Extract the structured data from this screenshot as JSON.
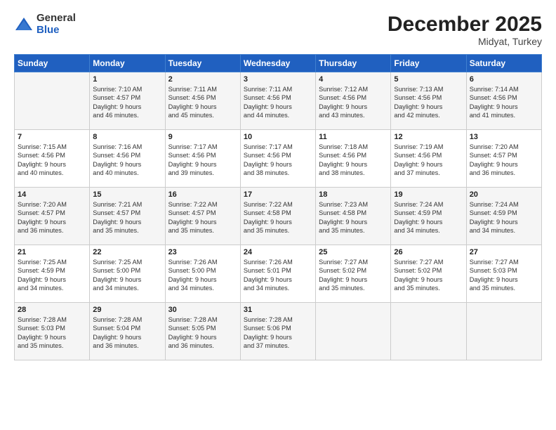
{
  "logo": {
    "general": "General",
    "blue": "Blue"
  },
  "title": "December 2025",
  "subtitle": "Midyat, Turkey",
  "header_days": [
    "Sunday",
    "Monday",
    "Tuesday",
    "Wednesday",
    "Thursday",
    "Friday",
    "Saturday"
  ],
  "weeks": [
    [
      {
        "day": "",
        "lines": []
      },
      {
        "day": "1",
        "lines": [
          "Sunrise: 7:10 AM",
          "Sunset: 4:57 PM",
          "Daylight: 9 hours",
          "and 46 minutes."
        ]
      },
      {
        "day": "2",
        "lines": [
          "Sunrise: 7:11 AM",
          "Sunset: 4:56 PM",
          "Daylight: 9 hours",
          "and 45 minutes."
        ]
      },
      {
        "day": "3",
        "lines": [
          "Sunrise: 7:11 AM",
          "Sunset: 4:56 PM",
          "Daylight: 9 hours",
          "and 44 minutes."
        ]
      },
      {
        "day": "4",
        "lines": [
          "Sunrise: 7:12 AM",
          "Sunset: 4:56 PM",
          "Daylight: 9 hours",
          "and 43 minutes."
        ]
      },
      {
        "day": "5",
        "lines": [
          "Sunrise: 7:13 AM",
          "Sunset: 4:56 PM",
          "Daylight: 9 hours",
          "and 42 minutes."
        ]
      },
      {
        "day": "6",
        "lines": [
          "Sunrise: 7:14 AM",
          "Sunset: 4:56 PM",
          "Daylight: 9 hours",
          "and 41 minutes."
        ]
      }
    ],
    [
      {
        "day": "7",
        "lines": [
          "Sunrise: 7:15 AM",
          "Sunset: 4:56 PM",
          "Daylight: 9 hours",
          "and 40 minutes."
        ]
      },
      {
        "day": "8",
        "lines": [
          "Sunrise: 7:16 AM",
          "Sunset: 4:56 PM",
          "Daylight: 9 hours",
          "and 40 minutes."
        ]
      },
      {
        "day": "9",
        "lines": [
          "Sunrise: 7:17 AM",
          "Sunset: 4:56 PM",
          "Daylight: 9 hours",
          "and 39 minutes."
        ]
      },
      {
        "day": "10",
        "lines": [
          "Sunrise: 7:17 AM",
          "Sunset: 4:56 PM",
          "Daylight: 9 hours",
          "and 38 minutes."
        ]
      },
      {
        "day": "11",
        "lines": [
          "Sunrise: 7:18 AM",
          "Sunset: 4:56 PM",
          "Daylight: 9 hours",
          "and 38 minutes."
        ]
      },
      {
        "day": "12",
        "lines": [
          "Sunrise: 7:19 AM",
          "Sunset: 4:56 PM",
          "Daylight: 9 hours",
          "and 37 minutes."
        ]
      },
      {
        "day": "13",
        "lines": [
          "Sunrise: 7:20 AM",
          "Sunset: 4:57 PM",
          "Daylight: 9 hours",
          "and 36 minutes."
        ]
      }
    ],
    [
      {
        "day": "14",
        "lines": [
          "Sunrise: 7:20 AM",
          "Sunset: 4:57 PM",
          "Daylight: 9 hours",
          "and 36 minutes."
        ]
      },
      {
        "day": "15",
        "lines": [
          "Sunrise: 7:21 AM",
          "Sunset: 4:57 PM",
          "Daylight: 9 hours",
          "and 35 minutes."
        ]
      },
      {
        "day": "16",
        "lines": [
          "Sunrise: 7:22 AM",
          "Sunset: 4:57 PM",
          "Daylight: 9 hours",
          "and 35 minutes."
        ]
      },
      {
        "day": "17",
        "lines": [
          "Sunrise: 7:22 AM",
          "Sunset: 4:58 PM",
          "Daylight: 9 hours",
          "and 35 minutes."
        ]
      },
      {
        "day": "18",
        "lines": [
          "Sunrise: 7:23 AM",
          "Sunset: 4:58 PM",
          "Daylight: 9 hours",
          "and 35 minutes."
        ]
      },
      {
        "day": "19",
        "lines": [
          "Sunrise: 7:24 AM",
          "Sunset: 4:59 PM",
          "Daylight: 9 hours",
          "and 34 minutes."
        ]
      },
      {
        "day": "20",
        "lines": [
          "Sunrise: 7:24 AM",
          "Sunset: 4:59 PM",
          "Daylight: 9 hours",
          "and 34 minutes."
        ]
      }
    ],
    [
      {
        "day": "21",
        "lines": [
          "Sunrise: 7:25 AM",
          "Sunset: 4:59 PM",
          "Daylight: 9 hours",
          "and 34 minutes."
        ]
      },
      {
        "day": "22",
        "lines": [
          "Sunrise: 7:25 AM",
          "Sunset: 5:00 PM",
          "Daylight: 9 hours",
          "and 34 minutes."
        ]
      },
      {
        "day": "23",
        "lines": [
          "Sunrise: 7:26 AM",
          "Sunset: 5:00 PM",
          "Daylight: 9 hours",
          "and 34 minutes."
        ]
      },
      {
        "day": "24",
        "lines": [
          "Sunrise: 7:26 AM",
          "Sunset: 5:01 PM",
          "Daylight: 9 hours",
          "and 34 minutes."
        ]
      },
      {
        "day": "25",
        "lines": [
          "Sunrise: 7:27 AM",
          "Sunset: 5:02 PM",
          "Daylight: 9 hours",
          "and 35 minutes."
        ]
      },
      {
        "day": "26",
        "lines": [
          "Sunrise: 7:27 AM",
          "Sunset: 5:02 PM",
          "Daylight: 9 hours",
          "and 35 minutes."
        ]
      },
      {
        "day": "27",
        "lines": [
          "Sunrise: 7:27 AM",
          "Sunset: 5:03 PM",
          "Daylight: 9 hours",
          "and 35 minutes."
        ]
      }
    ],
    [
      {
        "day": "28",
        "lines": [
          "Sunrise: 7:28 AM",
          "Sunset: 5:03 PM",
          "Daylight: 9 hours",
          "and 35 minutes."
        ]
      },
      {
        "day": "29",
        "lines": [
          "Sunrise: 7:28 AM",
          "Sunset: 5:04 PM",
          "Daylight: 9 hours",
          "and 36 minutes."
        ]
      },
      {
        "day": "30",
        "lines": [
          "Sunrise: 7:28 AM",
          "Sunset: 5:05 PM",
          "Daylight: 9 hours",
          "and 36 minutes."
        ]
      },
      {
        "day": "31",
        "lines": [
          "Sunrise: 7:28 AM",
          "Sunset: 5:06 PM",
          "Daylight: 9 hours",
          "and 37 minutes."
        ]
      },
      {
        "day": "",
        "lines": []
      },
      {
        "day": "",
        "lines": []
      },
      {
        "day": "",
        "lines": []
      }
    ]
  ]
}
